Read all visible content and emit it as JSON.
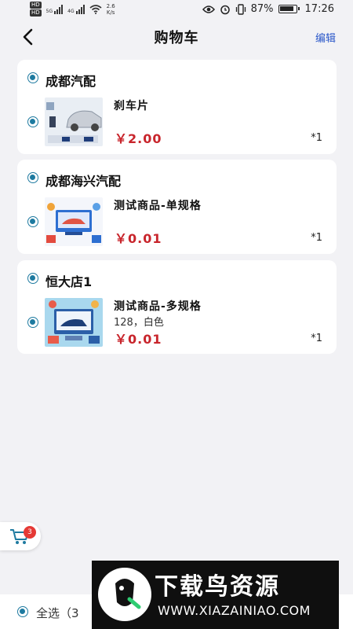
{
  "status_bar": {
    "hd1": "HD",
    "hd2": "HD",
    "net_type1": "5G",
    "net_type2": "4G",
    "net_speed": "2.6",
    "net_speed_unit": "K/s",
    "battery": "87%",
    "time": "17:26"
  },
  "header": {
    "title": "购物车",
    "edit_label": "编辑"
  },
  "stores": [
    {
      "name": "成都汽配",
      "items": [
        {
          "name": "刹车片",
          "spec": "",
          "price": "￥2.00",
          "qty": "*1"
        }
      ]
    },
    {
      "name": "成都海兴汽配",
      "items": [
        {
          "name": "测试商品-单规格",
          "spec": "",
          "price": "￥0.01",
          "qty": "*1"
        }
      ]
    },
    {
      "name": "恒大店1",
      "items": [
        {
          "name": "测试商品-多规格",
          "spec": "128，白色",
          "price": "￥0.01",
          "qty": "*1"
        }
      ]
    }
  ],
  "fab": {
    "badge": "3"
  },
  "bottom": {
    "select_all": "全选（3"
  },
  "watermark": {
    "main": "下载鸟资源",
    "sub": "WWW.XIAZAINIAO.COM"
  },
  "colors": {
    "accent": "#1e7aa0",
    "price": "#c8252c",
    "edit": "#2a57c9"
  }
}
